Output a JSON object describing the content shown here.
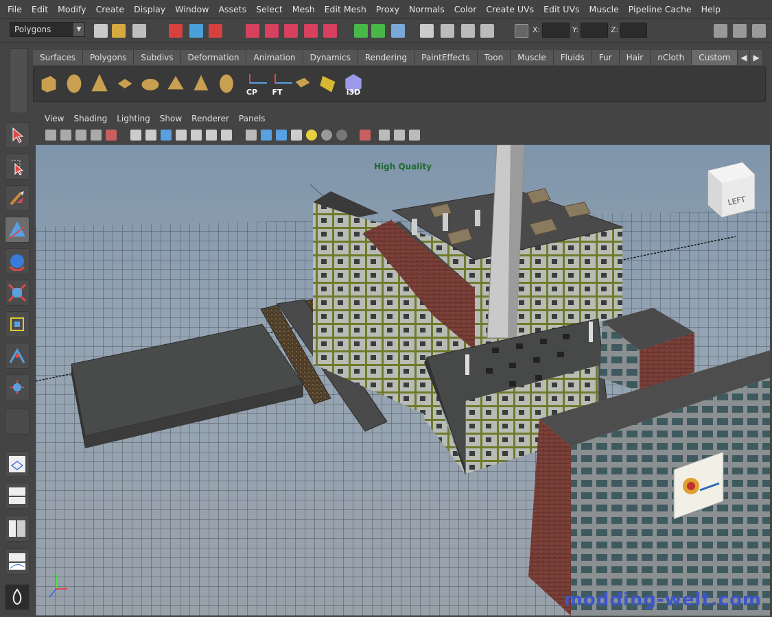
{
  "menu": [
    "File",
    "Edit",
    "Modify",
    "Create",
    "Display",
    "Window",
    "Assets",
    "Select",
    "Mesh",
    "Edit Mesh",
    "Proxy",
    "Normals",
    "Color",
    "Create UVs",
    "Edit UVs",
    "Muscle",
    "Pipeline Cache",
    "Help"
  ],
  "status_line": {
    "mode": "Polygons",
    "x_label": "X:",
    "y_label": "Y:",
    "z_label": "Z:"
  },
  "shelf": {
    "tabs": [
      "Surfaces",
      "Polygons",
      "Subdivs",
      "Deformation",
      "Animation",
      "Dynamics",
      "Rendering",
      "PaintEffects",
      "Toon",
      "Muscle",
      "Fluids",
      "Fur",
      "Hair",
      "nCloth",
      "Custom"
    ],
    "active_tab": "Custom",
    "icons": [
      {
        "name": "poly-cube"
      },
      {
        "name": "poly-cylinder"
      },
      {
        "name": "poly-cone"
      },
      {
        "name": "poly-plane"
      },
      {
        "name": "poly-torus"
      },
      {
        "name": "poly-prism"
      },
      {
        "name": "poly-pyramid"
      },
      {
        "name": "poly-pipe"
      },
      {
        "name": "center-pivot",
        "label": "CP"
      },
      {
        "name": "freeze-transforms",
        "label": "FT"
      },
      {
        "name": "uv-tool"
      },
      {
        "name": "uv-map"
      },
      {
        "name": "i3d-export",
        "label": "i3D"
      }
    ]
  },
  "panel": {
    "menus": [
      "View",
      "Shading",
      "Lighting",
      "Show",
      "Renderer",
      "Panels"
    ]
  },
  "viewport": {
    "quality_label": "High Quality",
    "viewcube_label": "LEFT",
    "watermark": "modding-welt.com"
  },
  "colors": {
    "ui_bg": "#444444",
    "accent_blue": "#3c56c8",
    "hq_green": "#1c6b2e"
  }
}
